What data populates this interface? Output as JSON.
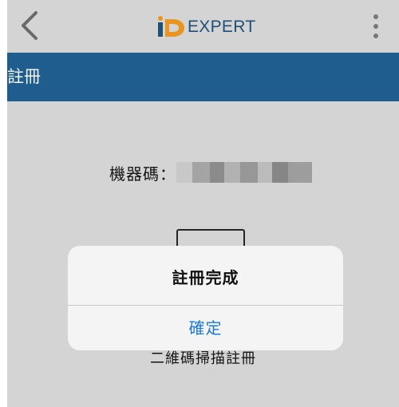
{
  "header": {
    "logo_icon": "iD-logo-icon",
    "logo_text": "EXPERT",
    "back_icon": "chevron-left-icon",
    "menu_icon": "more-vertical-icon"
  },
  "titlebar": {
    "title": "註冊"
  },
  "main": {
    "machine_code_label": "機器碼：",
    "machine_code_value": "",
    "scan_label": "二維碼掃描註冊"
  },
  "dialog": {
    "title": "註冊完成",
    "confirm_label": "確定"
  },
  "colors": {
    "accent": "#1d5e93",
    "link": "#1a7ad8",
    "background": "#dcdcdc",
    "logo_blue": "#1d4f7a",
    "logo_orange": "#f39a1e"
  }
}
